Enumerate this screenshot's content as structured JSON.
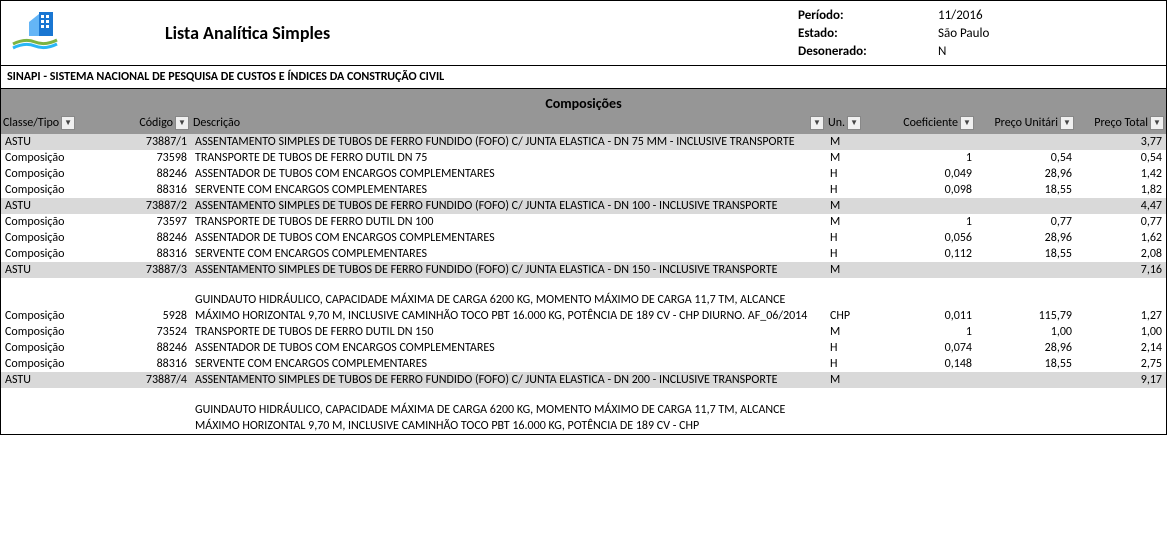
{
  "header": {
    "title": "Lista Analítica Simples",
    "subtitle": "SINAPI - SISTEMA NACIONAL DE PESQUISA DE CUSTOS E ÍNDICES DA CONSTRUÇÃO CIVIL",
    "meta": {
      "period_label": "Período:",
      "period_value": "11/2016",
      "state_label": "Estado:",
      "state_value": "São Paulo",
      "deson_label": "Desonerado:",
      "deson_value": "N"
    }
  },
  "section_title": "Composições",
  "columns": {
    "classe": "Classe/Tipo",
    "codigo": "Código",
    "desc": "Descrição",
    "un": "Un.",
    "coef": "Coeficiente",
    "pu": "Preço Unitári",
    "pt": "Preço Total"
  },
  "rows": [
    {
      "type": "group",
      "classe": "ASTU",
      "codigo": "73887/1",
      "desc": "ASSENTAMENTO SIMPLES DE TUBOS DE FERRO FUNDIDO (FOFO) C/ JUNTA ELASTICA -  DN 75 MM - INCLUSIVE TRANSPORTE",
      "un": "M",
      "coef": "",
      "pu": "",
      "pt": "3,77"
    },
    {
      "type": "item",
      "classe": "Composição",
      "codigo": "73598",
      "desc": "TRANSPORTE DE TUBOS DE FERRO DUTIL DN 75",
      "un": "M",
      "coef": "1",
      "pu": "0,54",
      "pt": "0,54"
    },
    {
      "type": "item",
      "classe": "Composição",
      "codigo": "88246",
      "desc": "ASSENTADOR DE TUBOS COM ENCARGOS COMPLEMENTARES",
      "un": "H",
      "coef": "0,049",
      "pu": "28,96",
      "pt": "1,42"
    },
    {
      "type": "item",
      "classe": "Composição",
      "codigo": "88316",
      "desc": "SERVENTE COM ENCARGOS COMPLEMENTARES",
      "un": "H",
      "coef": "0,098",
      "pu": "18,55",
      "pt": "1,82"
    },
    {
      "type": "group",
      "classe": "ASTU",
      "codigo": "73887/2",
      "desc": "ASSENTAMENTO SIMPLES DE TUBOS DE FERRO FUNDIDO (FOFO) C/ JUNTA ELASTICA - DN 100 - INCLUSIVE TRANSPORTE",
      "un": "M",
      "coef": "",
      "pu": "",
      "pt": "4,47"
    },
    {
      "type": "item",
      "classe": "Composição",
      "codigo": "73597",
      "desc": "TRANSPORTE DE TUBOS DE FERRO DUTIL DN 100",
      "un": "M",
      "coef": "1",
      "pu": "0,77",
      "pt": "0,77"
    },
    {
      "type": "item",
      "classe": "Composição",
      "codigo": "88246",
      "desc": "ASSENTADOR DE TUBOS COM ENCARGOS COMPLEMENTARES",
      "un": "H",
      "coef": "0,056",
      "pu": "28,96",
      "pt": "1,62"
    },
    {
      "type": "item",
      "classe": "Composição",
      "codigo": "88316",
      "desc": "SERVENTE COM ENCARGOS COMPLEMENTARES",
      "un": "H",
      "coef": "0,112",
      "pu": "18,55",
      "pt": "2,08"
    },
    {
      "type": "group",
      "classe": "ASTU",
      "codigo": "73887/3",
      "desc": "ASSENTAMENTO SIMPLES DE TUBOS DE FERRO FUNDIDO (FOFO) C/ JUNTA ELASTICA - DN 150 - INCLUSIVE TRANSPORTE",
      "un": "M",
      "coef": "",
      "pu": "",
      "pt": "7,16"
    },
    {
      "type": "item",
      "classe": "Composição",
      "codigo": "5928",
      "desc": "GUINDAUTO HIDRÁULICO, CAPACIDADE MÁXIMA DE CARGA 6200 KG, MOMENTO MÁXIMO DE CARGA 11,7 TM, ALCANCE MÁXIMO HORIZONTAL 9,70 M, INCLUSIVE CAMINHÃO TOCO PBT 16.000 KG, POTÊNCIA DE 189 CV - CHP DIURNO. AF_06/2014",
      "un": "CHP",
      "coef": "0,011",
      "pu": "115,79",
      "pt": "1,27",
      "pad": true
    },
    {
      "type": "item",
      "classe": "Composição",
      "codigo": "73524",
      "desc": "TRANSPORTE DE TUBOS DE FERRO DUTIL DN 150",
      "un": "M",
      "coef": "1",
      "pu": "1,00",
      "pt": "1,00"
    },
    {
      "type": "item",
      "classe": "Composição",
      "codigo": "88246",
      "desc": "ASSENTADOR DE TUBOS COM ENCARGOS COMPLEMENTARES",
      "un": "H",
      "coef": "0,074",
      "pu": "28,96",
      "pt": "2,14"
    },
    {
      "type": "item",
      "classe": "Composição",
      "codigo": "88316",
      "desc": "SERVENTE COM ENCARGOS COMPLEMENTARES",
      "un": "H",
      "coef": "0,148",
      "pu": "18,55",
      "pt": "2,75"
    },
    {
      "type": "group",
      "classe": "ASTU",
      "codigo": "73887/4",
      "desc": "ASSENTAMENTO SIMPLES DE TUBOS DE FERRO FUNDIDO (FOFO) C/ JUNTA ELASTICA - DN 200 - INCLUSIVE TRANSPORTE",
      "un": "M",
      "coef": "",
      "pu": "",
      "pt": "9,17"
    },
    {
      "type": "item",
      "classe": "",
      "codigo": "",
      "desc": "GUINDAUTO HIDRÁULICO, CAPACIDADE MÁXIMA DE CARGA 6200 KG, MOMENTO MÁXIMO DE CARGA 11,7 TM, ALCANCE MÁXIMO HORIZONTAL 9,70 M, INCLUSIVE CAMINHÃO TOCO PBT 16.000 KG, POTÊNCIA DE 189 CV - CHP",
      "un": "",
      "coef": "",
      "pu": "",
      "pt": "",
      "pad": true,
      "partial": true
    }
  ]
}
